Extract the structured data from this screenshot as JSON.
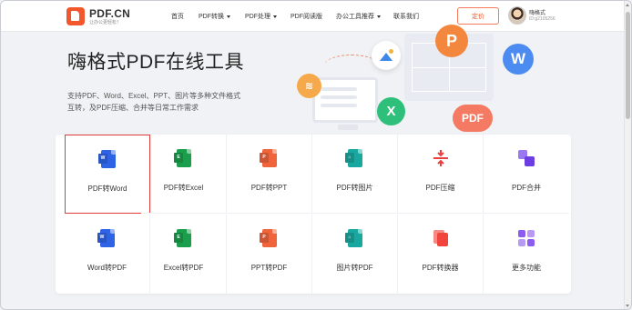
{
  "header": {
    "logo_name": "PDF.CN",
    "logo_slogan": "让办公更轻松！",
    "nav": [
      {
        "label": "首页",
        "caret": false
      },
      {
        "label": "PDF转换",
        "caret": true
      },
      {
        "label": "PDF处理",
        "caret": true
      },
      {
        "label": "PDF阅读版",
        "caret": false
      },
      {
        "label": "办公工具推荐",
        "caret": true
      },
      {
        "label": "联系我们",
        "caret": false
      }
    ],
    "buy_label": "定价",
    "user_name": "嗨格式",
    "user_id": "ID:g2105256"
  },
  "hero": {
    "title": "嗨格式PDF在线工具",
    "desc_line1": "支持PDF、Word、Excel、PPT、图片等多种文件格式",
    "desc_line2": "互转，及PDF压缩、合并等日常工作需求"
  },
  "illustration": {
    "bubble_p": "P",
    "bubble_w": "W",
    "bubble_x": "X",
    "bubble_pdf": "PDF",
    "bubble_zip": "≋"
  },
  "tools": [
    {
      "label": "PDF转Word",
      "icon": "pdf-to-word-icon",
      "color": "#2f63e6",
      "letter": "W",
      "selected": true
    },
    {
      "label": "PDF转Excel",
      "icon": "pdf-to-excel-icon",
      "color": "#1b9e4b",
      "letter": "E",
      "selected": false
    },
    {
      "label": "PDF转PPT",
      "icon": "pdf-to-ppt-icon",
      "color": "#f0643c",
      "letter": "P",
      "selected": false
    },
    {
      "label": "PDF转图片",
      "icon": "pdf-to-image-icon",
      "color": "#19a8a0",
      "letter": "⌂",
      "selected": false
    },
    {
      "label": "PDF压缩",
      "icon": "compress-icon",
      "color": "#e8423f",
      "letter": "",
      "selected": false
    },
    {
      "label": "PDF合并",
      "icon": "merge-icon",
      "color": "#7b4fe6",
      "letter": "",
      "selected": false
    },
    {
      "label": "Word转PDF",
      "icon": "word-to-pdf-icon",
      "color": "#2f63e6",
      "letter": "W",
      "selected": false
    },
    {
      "label": "Excel转PDF",
      "icon": "excel-to-pdf-icon",
      "color": "#1b9e4b",
      "letter": "E",
      "selected": false
    },
    {
      "label": "PPT转PDF",
      "icon": "ppt-to-pdf-icon",
      "color": "#f0643c",
      "letter": "P",
      "selected": false
    },
    {
      "label": "图片转PDF",
      "icon": "image-to-pdf-icon",
      "color": "#19a8a0",
      "letter": "⌂",
      "selected": false
    },
    {
      "label": "PDF转换器",
      "icon": "converter-icon",
      "color": "#f0443c",
      "letter": "",
      "selected": false
    },
    {
      "label": "更多功能",
      "icon": "more-features-icon",
      "color": "#8c5cf0",
      "letter": "",
      "selected": false
    }
  ],
  "colors": {
    "brand": "#f4562b",
    "selected_border": "#e03a3a"
  }
}
